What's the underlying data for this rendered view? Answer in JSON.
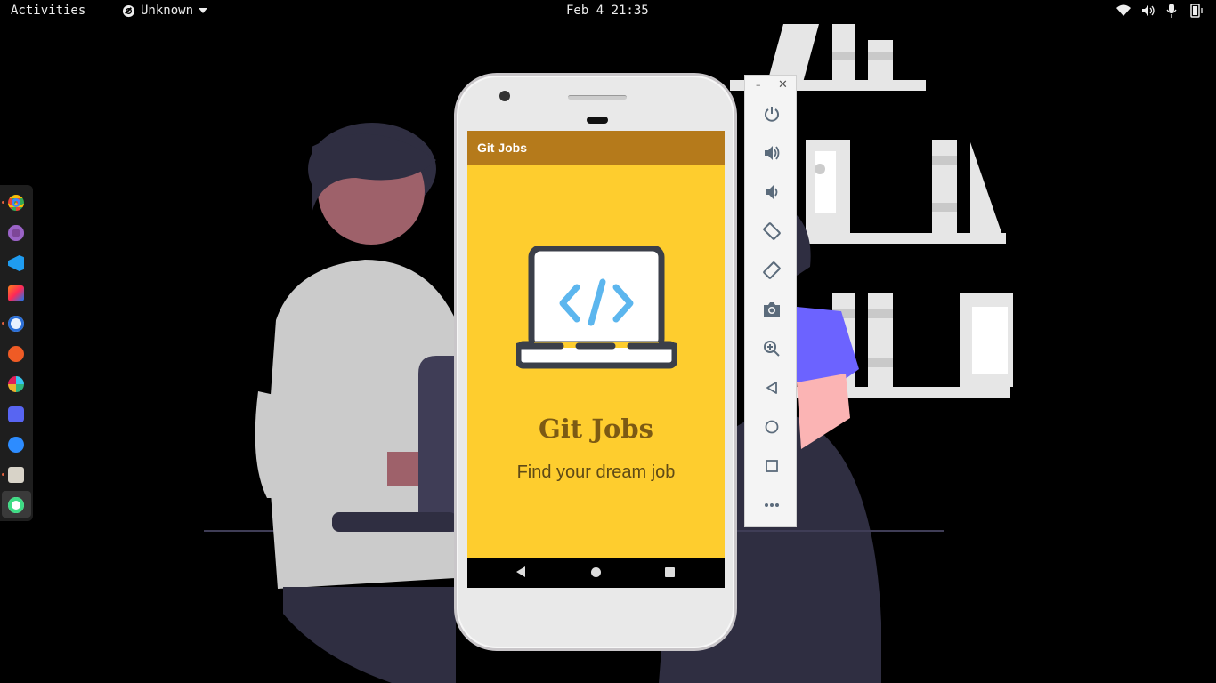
{
  "topbar": {
    "activities_label": "Activities",
    "app_menu_label": "Unknown",
    "clock": "Feb 4  21:35",
    "tray_icons": [
      "wifi-icon",
      "volume-icon",
      "microphone-icon",
      "battery-icon"
    ]
  },
  "dock": {
    "apps": [
      "chrome",
      "tor-browser",
      "vscode",
      "intellij",
      "app-5",
      "postman",
      "slack",
      "discord",
      "zoom",
      "files",
      "android-emulator"
    ]
  },
  "emulator": {
    "app_bar_title": "Git Jobs",
    "headline": "Git Jobs",
    "tagline": "Find your dream job",
    "colors": {
      "app_bar": "#b57a1b",
      "screen_bg": "#fecd2e",
      "code_brackets": "#5cb6ee",
      "laptop_outline": "#3b3f49"
    }
  },
  "emulator_toolbar": {
    "buttons": [
      "power-icon",
      "volume-up-icon",
      "volume-down-icon",
      "rotate-left-icon",
      "rotate-right-icon",
      "camera-icon",
      "zoom-icon",
      "back-icon",
      "home-icon",
      "overview-icon",
      "more-icon"
    ]
  }
}
